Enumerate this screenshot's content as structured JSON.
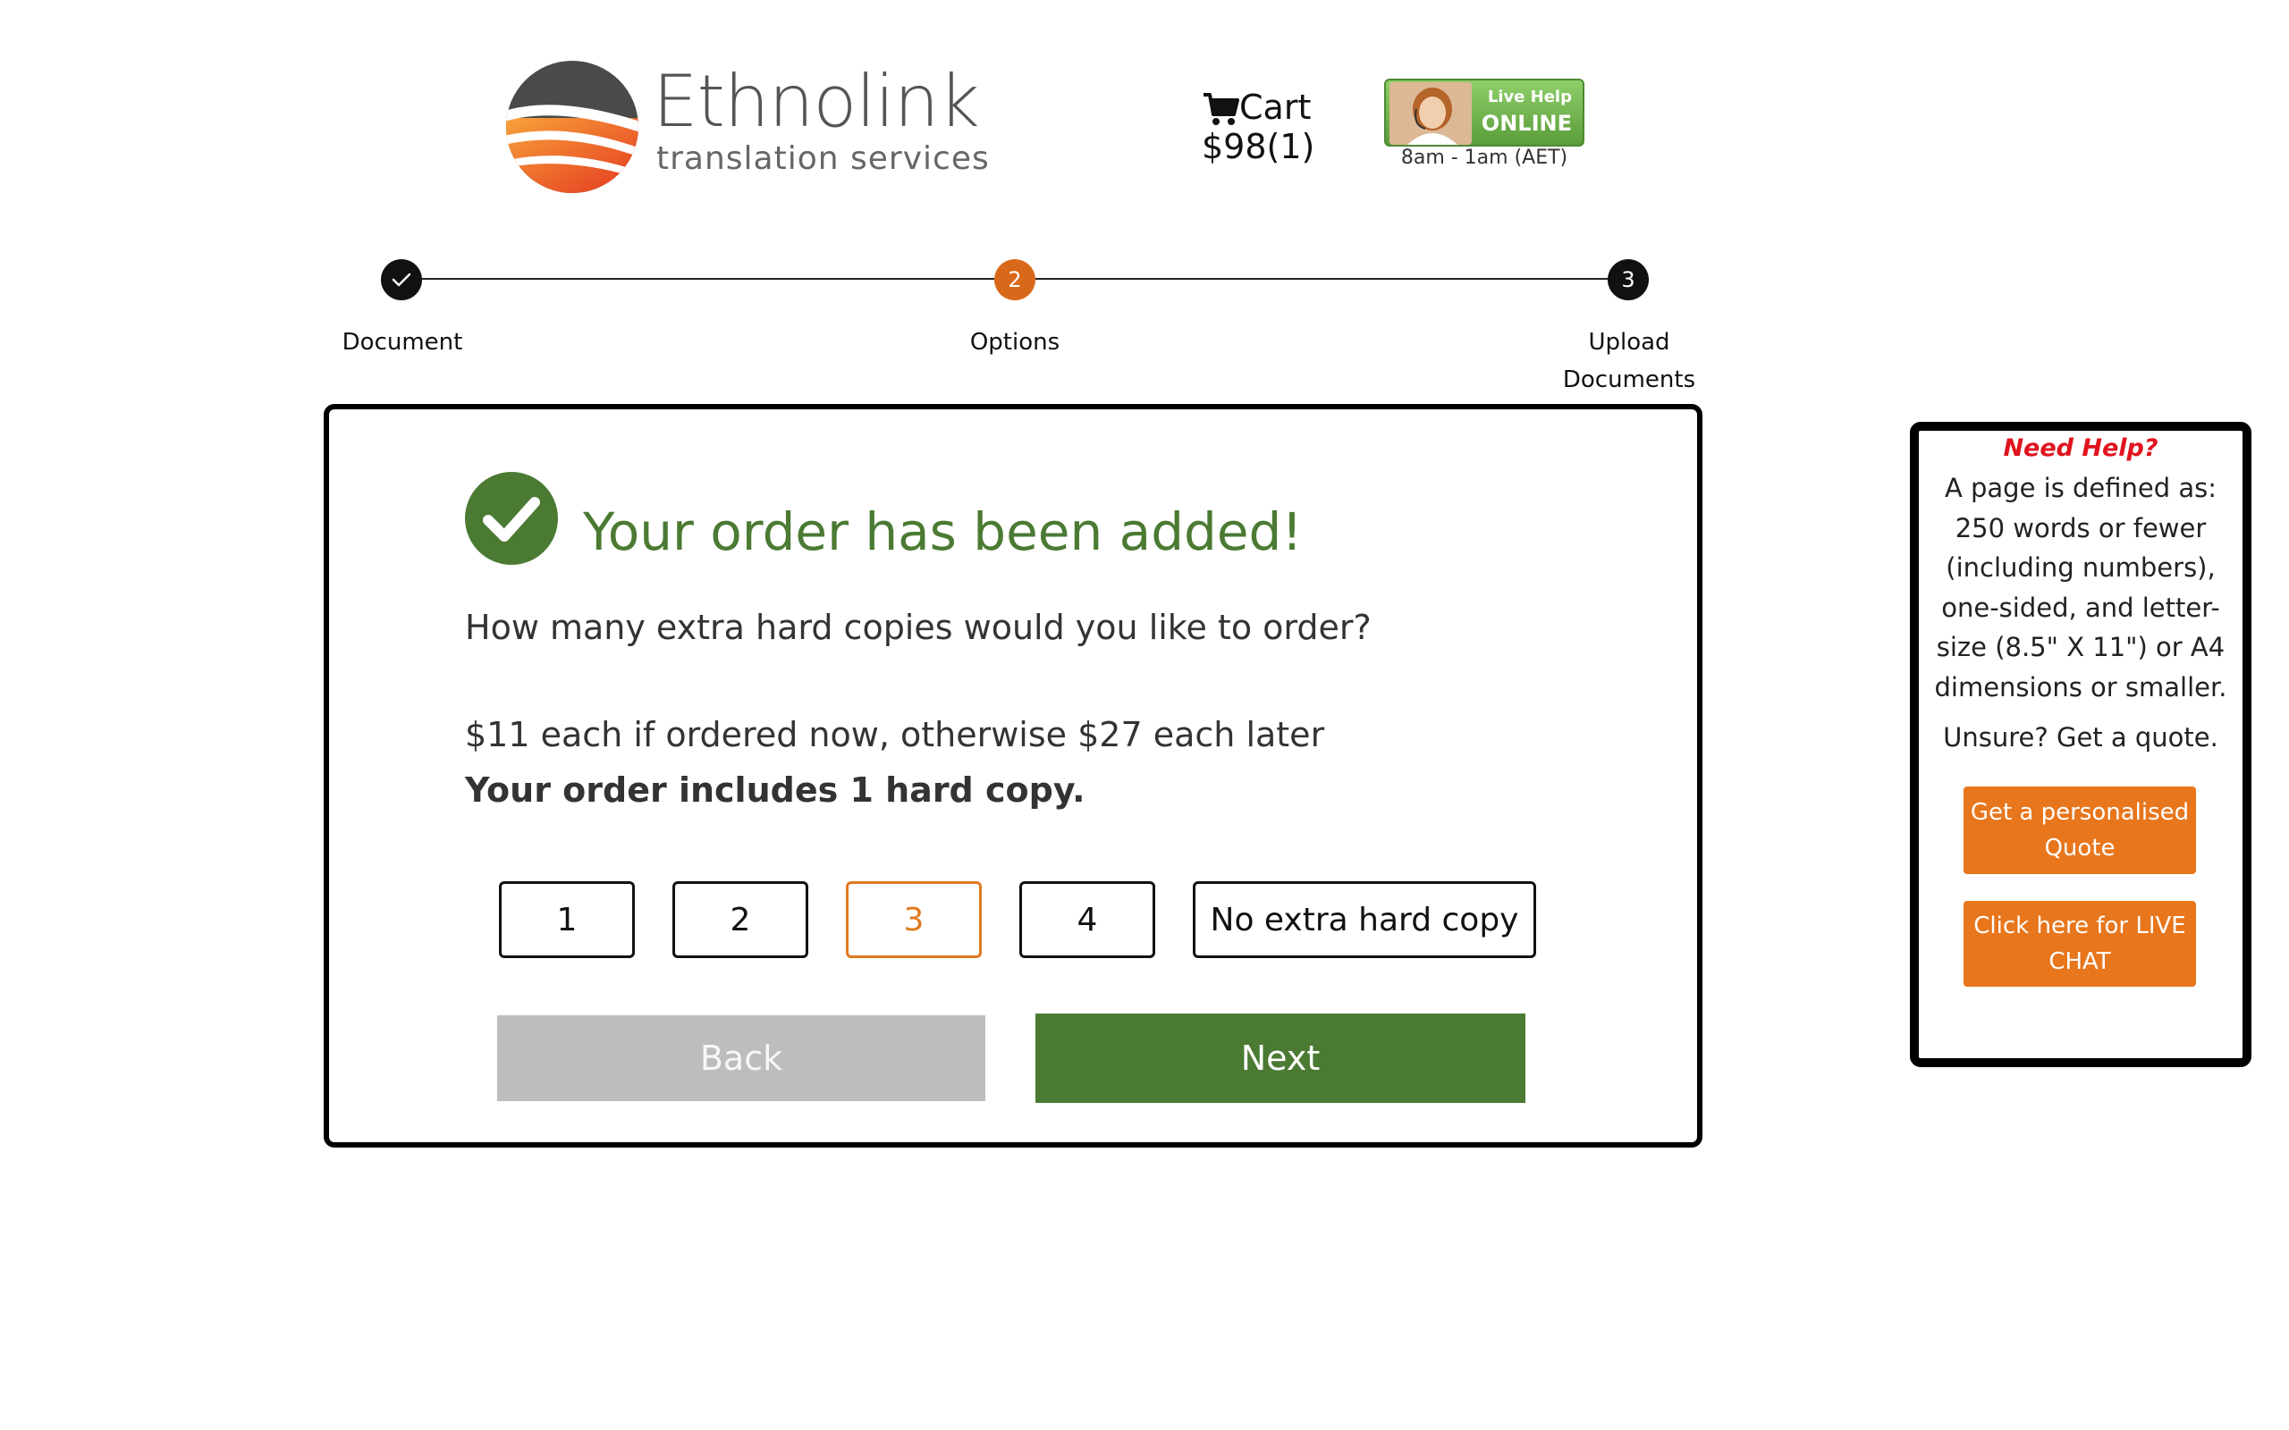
{
  "header": {
    "logo_name": "Ethnolink",
    "logo_tagline": "translation services",
    "cart_label": "Cart",
    "cart_total": "$98(1)",
    "live_help_line1": "Live Help",
    "live_help_line2": "ONLINE",
    "hours": "8am - 1am (AET)"
  },
  "steps": [
    {
      "label": "Document",
      "state": "complete"
    },
    {
      "label": "Options",
      "number": "2",
      "state": "current"
    },
    {
      "label_line1": "Upload",
      "label_line2": "Documents",
      "number": "3",
      "state": "upcoming"
    }
  ],
  "main": {
    "headline": "Your order has been added!",
    "question": "How many extra hard copies would you like to order?",
    "pricing": "$11 each if ordered now, otherwise $27 each later",
    "included": "Your order includes 1 hard copy.",
    "quantity_options": [
      {
        "label": "1",
        "selected": false
      },
      {
        "label": "2",
        "selected": false
      },
      {
        "label": "3",
        "selected": true
      },
      {
        "label": "4",
        "selected": false
      },
      {
        "label": "No extra hard copy",
        "selected": false
      }
    ],
    "back_label": "Back",
    "next_label": "Next"
  },
  "help": {
    "title": "Need Help?",
    "body": "A page is defined as: 250 words or fewer (including numbers), one-sided, and letter-size (8.5\" X 11\") or A4 dimensions or smaller.",
    "unsure": "Unsure? Get a quote.",
    "quote_button": "Get a personalised Quote",
    "chat_button": "Click here for LIVE CHAT"
  },
  "colors": {
    "brand_green": "#4b7a33",
    "brand_orange": "#e07a1f",
    "help_red": "#e0141e",
    "disabled_gray": "#bdbdbd"
  },
  "icons": {
    "logo": "ethnolink-logo-icon",
    "cart": "shopping-cart-icon",
    "step_complete": "checkmark-icon",
    "success": "check-circle-icon"
  }
}
